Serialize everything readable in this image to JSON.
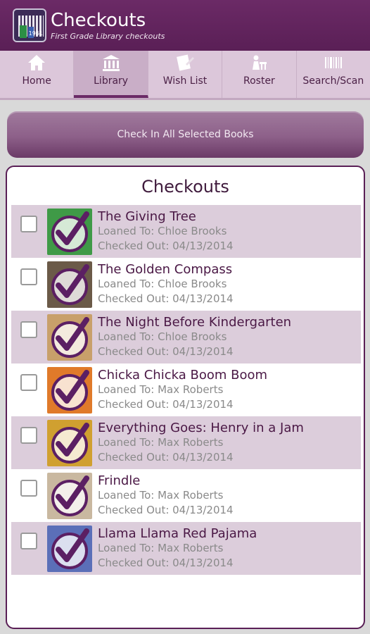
{
  "header": {
    "title": "Checkouts",
    "subtitle": "First Grade Library checkouts",
    "app_icon_tag": "1961"
  },
  "tabs": [
    {
      "label": "Home",
      "icon": "home-icon",
      "active": false
    },
    {
      "label": "Library",
      "icon": "library-icon",
      "active": true
    },
    {
      "label": "Wish List",
      "icon": "wish-list-icon",
      "active": false
    },
    {
      "label": "Roster",
      "icon": "roster-icon",
      "active": false
    },
    {
      "label": "Search/Scan",
      "icon": "barcode-icon",
      "active": false
    }
  ],
  "checkin_button": "Check In All Selected Books",
  "panel_title": "Checkouts",
  "colors": {
    "brand": "#5a1f56",
    "row_shade": "#dccddb",
    "check_mark": "#5b1f63"
  },
  "books": [
    {
      "title": "The Giving Tree",
      "loaned": "Loaned To: Chloe Brooks",
      "checked_out": "Checked Out: 04/13/2014",
      "cover": "#3f9a47"
    },
    {
      "title": "The Golden Compass",
      "loaned": "Loaned To: Chloe Brooks",
      "checked_out": "Checked Out: 04/13/2014",
      "cover": "#6b5a48"
    },
    {
      "title": "The Night Before Kindergarten",
      "loaned": "Loaned To: Chloe Brooks",
      "checked_out": "Checked Out: 04/13/2014",
      "cover": "#c8a06a"
    },
    {
      "title": "Chicka Chicka Boom Boom",
      "loaned": "Loaned To: Max Roberts",
      "checked_out": "Checked Out: 04/13/2014",
      "cover": "#e07a2a"
    },
    {
      "title": "Everything Goes: Henry in a Jam",
      "loaned": "Loaned To: Max Roberts",
      "checked_out": "Checked Out: 04/13/2014",
      "cover": "#d0a030"
    },
    {
      "title": "Frindle",
      "loaned": "Loaned To: Max Roberts",
      "checked_out": "Checked Out: 04/13/2014",
      "cover": "#c9b8a0"
    },
    {
      "title": "Llama Llama Red Pajama",
      "loaned": "Loaned To: Max Roberts",
      "checked_out": "Checked Out: 04/13/2014",
      "cover": "#5b6fb8"
    }
  ]
}
